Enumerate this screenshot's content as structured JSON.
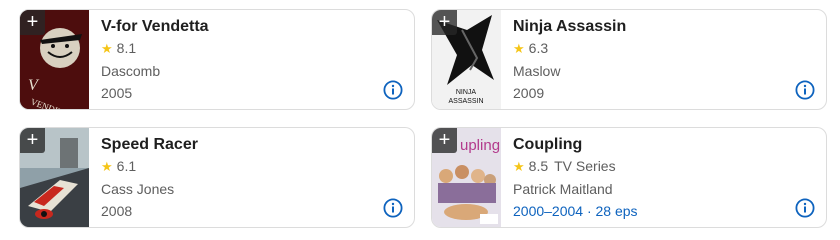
{
  "cards": [
    {
      "title": "V-for Vendetta",
      "rating": "8.1",
      "type": "",
      "credit": "Dascomb",
      "years": "2005",
      "poster_text": "VENDETTA",
      "poster_colors": [
        "#7a1212",
        "#1a0c0c",
        "#d8d0c0"
      ]
    },
    {
      "title": "Ninja Assassin",
      "rating": "6.3",
      "type": "",
      "credit": "Maslow",
      "years": "2009",
      "poster_text": "NINJA ASSASSIN",
      "poster_colors": [
        "#f2f2f2",
        "#111111",
        "#555555"
      ]
    },
    {
      "title": "Speed Racer",
      "rating": "6.1",
      "type": "",
      "credit": "Cass Jones",
      "years": "2008",
      "poster_text": "",
      "poster_colors": [
        "#8fa0a8",
        "#c8281e",
        "#e7e2d5"
      ]
    },
    {
      "title": "Coupling",
      "rating": "8.5",
      "type": "TV Series",
      "credit": "Patrick Maitland",
      "years": "2000–2004 · 28 eps",
      "poster_text": "upling",
      "poster_colors": [
        "#e5e1ea",
        "#b33a8c",
        "#d9a878"
      ]
    }
  ],
  "icons": {
    "add": "+",
    "star": "★",
    "info": "info-icon"
  },
  "colors": {
    "accent": "#0e63be",
    "star": "#f5c518"
  }
}
